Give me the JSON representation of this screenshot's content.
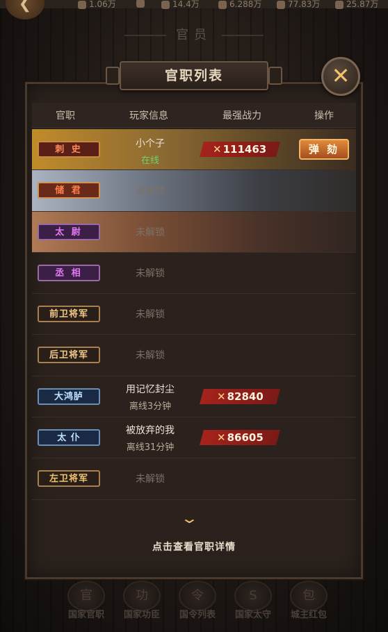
{
  "topbar": {
    "back_icon": "back-arrow-icon",
    "resources": [
      {
        "icon": "coin-icon",
        "value": "1.06万"
      },
      {
        "icon": "plus-icon",
        "value": ""
      },
      {
        "icon": "food-icon",
        "value": "14.4万"
      },
      {
        "icon": "wood-icon",
        "value": "6.288万"
      },
      {
        "icon": "iron-icon",
        "value": "77.83万"
      },
      {
        "icon": "soldier-icon",
        "value": "25.87万"
      }
    ]
  },
  "page_title": "官员",
  "panel": {
    "title": "官职列表",
    "close_icon": "close-icon",
    "columns": [
      "官职",
      "玩家信息",
      "最强战力",
      "操作"
    ],
    "rows": [
      {
        "rank": "刺 史",
        "player": "小个子",
        "status": "在线",
        "power": "111463",
        "action": "弹 劾"
      },
      {
        "rank": "储 君",
        "locked": "未解锁"
      },
      {
        "rank": "太 尉",
        "locked": "未解锁"
      },
      {
        "rank": "丞 相",
        "locked": "未解锁"
      },
      {
        "rank": "前卫将军",
        "locked": "未解锁"
      },
      {
        "rank": "后卫将军",
        "locked": "未解锁"
      },
      {
        "rank": "大鸿胪",
        "player": "用记忆封尘",
        "status": "离线3分钟",
        "power": "82840"
      },
      {
        "rank": "太 仆",
        "player": "被放弃的我",
        "status": "离线31分钟",
        "power": "86605"
      },
      {
        "rank": "左卫将军",
        "locked": "未解锁"
      }
    ],
    "power_prefix": "✕",
    "detail_link": "点击查看官职详情"
  },
  "bottom_nav": [
    {
      "label": "国家官职",
      "icon": "official-icon"
    },
    {
      "label": "国家功臣",
      "icon": "merit-icon"
    },
    {
      "label": "国令列表",
      "icon": "decree-icon"
    },
    {
      "label": "国家太守",
      "icon": "governor-icon"
    },
    {
      "label": "城主红包",
      "icon": "red-envelope-icon"
    }
  ]
}
